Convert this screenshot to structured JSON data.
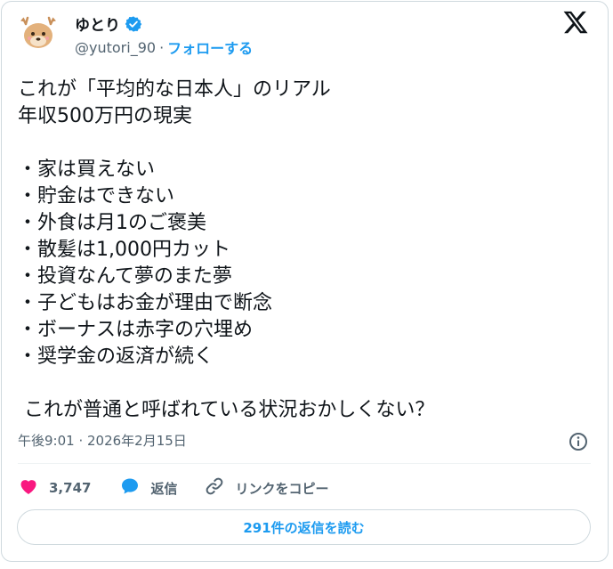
{
  "author": {
    "name": "ゆとり",
    "handle": "@yutori_90",
    "separator": "·",
    "follow_label": "フォローする"
  },
  "tweet": {
    "lines": [
      "これが「平均的な日本人」のリアル",
      "年収500万円の現実",
      "",
      "・家は買えない",
      "・貯金はできない",
      "・外食は月1のご褒美",
      "・散髪は1,000円カット",
      "・投資なんて夢のまた夢",
      "・子どもはお金が理由で断念",
      "・ボーナスは赤字の穴埋め",
      "・奨学金の返済が続く",
      "",
      " これが普通と呼ばれている状況おかしくない？"
    ]
  },
  "meta": {
    "timestamp": "午後9:01 · 2026年2月15日"
  },
  "actions": {
    "like_count": "3,747",
    "reply_label": "返信",
    "copy_link_label": "リンクをコピー"
  },
  "read_replies_label": "291件の返信を読む",
  "colors": {
    "accent": "#1d9bf0",
    "like": "#f91880",
    "muted": "#536471"
  },
  "icons": [
    "avatar-deer",
    "verified-badge-icon",
    "x-logo-icon",
    "info-icon",
    "heart-icon",
    "reply-bubble-icon",
    "link-icon"
  ]
}
